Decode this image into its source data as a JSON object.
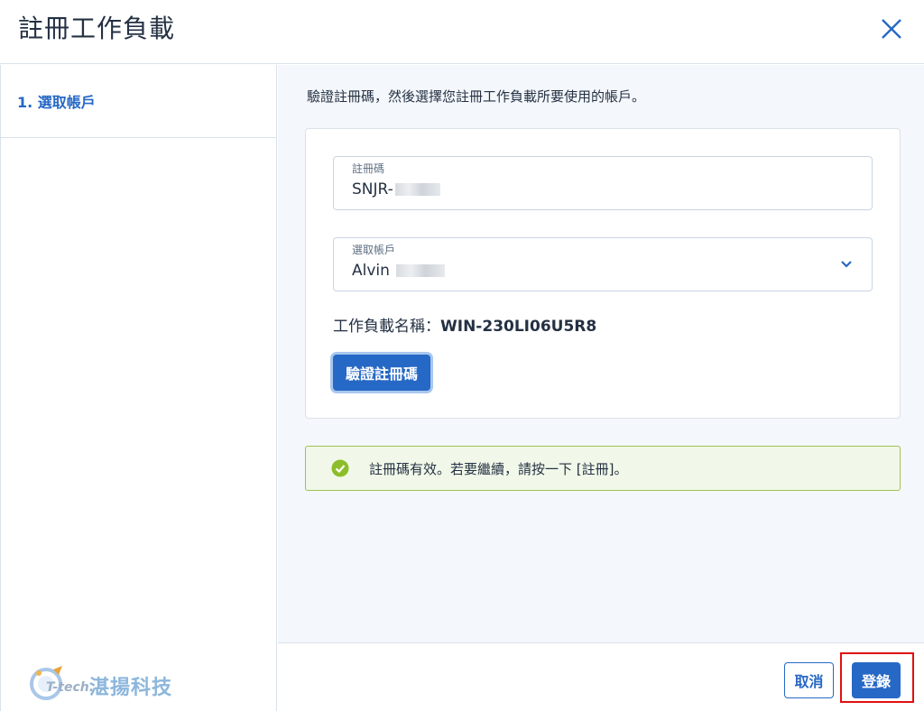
{
  "dialog": {
    "title": "註冊工作負載",
    "close_icon": "close-icon"
  },
  "sidebar": {
    "steps": [
      {
        "label": "1. 選取帳戶",
        "active": true
      }
    ],
    "logo": {
      "brand": "T-tech.",
      "name": "湛揚科技"
    }
  },
  "main": {
    "intro": "驗證註冊碼，然後選擇您註冊工作負載所要使用的帳戶。",
    "registration_code": {
      "label": "註冊碼",
      "value": "SNJR-"
    },
    "account": {
      "label": "選取帳戶",
      "value": "Alvin",
      "icon": "chevron-down-icon"
    },
    "workload_name": {
      "label": "工作負載名稱：",
      "value": "WIN-230LI06U5R8"
    },
    "verify_button": "驗證註冊碼",
    "alert": {
      "icon": "check-circle-icon",
      "text": "註冊碼有效。若要繼續，請按一下 [註冊]。"
    }
  },
  "footer": {
    "cancel_label": "取消",
    "register_label": "登錄"
  },
  "colors": {
    "accent": "#2668c5",
    "success": "#8cbd2a",
    "highlight": "#e01010"
  }
}
